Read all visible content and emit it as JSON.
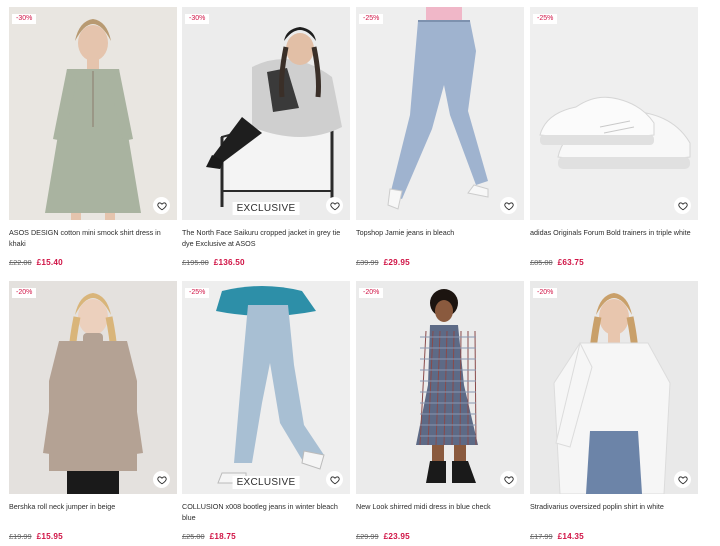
{
  "products": [
    {
      "discount": "-30%",
      "title": "ASOS DESIGN cotton mini smock shirt dress in khaki",
      "old_price": "£22.00",
      "new_price": "£15.40",
      "exclusive": "",
      "image": "model-khaki-smock-dress",
      "colors": {
        "bg": "#e9e6e1",
        "main": "#a9b3a0",
        "skin": "#e5c4ad",
        "hair": "#b89a72",
        "accent": "#8c7b6b"
      }
    },
    {
      "discount": "-30%",
      "title": "The North Face Saikuru cropped jacket in grey tie dye Exclusive at ASOS",
      "old_price": "£195.00",
      "new_price": "£136.50",
      "exclusive": "EXCLUSIVE",
      "image": "model-grey-puffer-jacket",
      "colors": {
        "bg": "#ececec",
        "main": "#cfcfcf",
        "skin": "#e2bfa6",
        "hair": "#3a2f28",
        "accent": "#1e1e1e"
      }
    },
    {
      "discount": "-25%",
      "title": "Topshop Jamie jeans in bleach",
      "old_price": "£39.99",
      "new_price": "£29.95",
      "exclusive": "",
      "image": "model-bleach-jeans",
      "colors": {
        "bg": "#eeeeee",
        "main": "#9fb3cf",
        "skin": "#e3c1aa",
        "hair": "#6b4f3b",
        "accent": "#f0b7c8"
      }
    },
    {
      "discount": "-25%",
      "title": "adidas Originals Forum Bold trainers in triple white",
      "old_price": "£85.00",
      "new_price": "£63.75",
      "exclusive": "",
      "image": "white-trainers",
      "colors": {
        "bg": "#efefef",
        "main": "#f8f8f8",
        "skin": "#e0e0e0",
        "hair": "#d6d6d6",
        "accent": "#c9c9c9"
      }
    },
    {
      "discount": "-20%",
      "title": "Bershka roll neck jumper in beige",
      "old_price": "£19.99",
      "new_price": "£15.95",
      "exclusive": "",
      "image": "model-beige-jumper",
      "colors": {
        "bg": "#e4e1de",
        "main": "#b4a294",
        "skin": "#ecd0bd",
        "hair": "#d9b57a",
        "accent": "#1a1a1a"
      }
    },
    {
      "discount": "-25%",
      "title": "COLLUSION x008 bootleg jeans in winter bleach blue",
      "old_price": "£25.00",
      "new_price": "£18.75",
      "exclusive": "EXCLUSIVE",
      "image": "model-bootleg-jeans",
      "colors": {
        "bg": "#eeeeee",
        "main": "#a8bfd3",
        "skin": "#d9b59c",
        "hair": "#4a3a2e",
        "accent": "#2d8fa8"
      }
    },
    {
      "discount": "-20%",
      "title": "New Look shirred midi dress in blue check",
      "old_price": "£29.99",
      "new_price": "£23.95",
      "exclusive": "",
      "image": "model-check-midi-dress",
      "colors": {
        "bg": "#ebebeb",
        "main": "#5d6a86",
        "skin": "#8a5a3e",
        "hair": "#1c1410",
        "accent": "#8a4a4a"
      }
    },
    {
      "discount": "-20%",
      "title": "Stradivarius oversized poplin shirt in white",
      "old_price": "£17.99",
      "new_price": "£14.35",
      "exclusive": "",
      "image": "model-white-poplin-shirt",
      "colors": {
        "bg": "#e9e9e9",
        "main": "#f6f6f6",
        "skin": "#e8c6ae",
        "hair": "#c9a06a",
        "accent": "#6c84a8"
      }
    }
  ]
}
